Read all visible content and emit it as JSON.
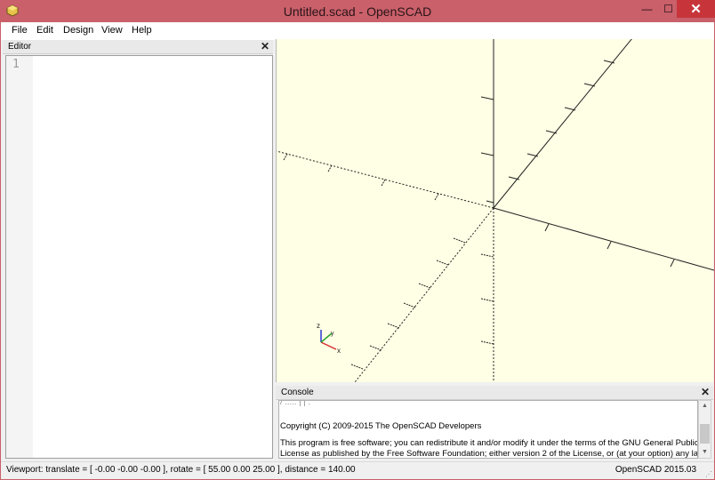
{
  "window": {
    "title": "Untitled.scad - OpenSCAD",
    "minimize_glyph": "—",
    "maximize_glyph": "☐",
    "close_glyph": "✕"
  },
  "menu": {
    "items": [
      {
        "label": "File"
      },
      {
        "label": "Edit"
      },
      {
        "label": "Design"
      },
      {
        "label": "View"
      },
      {
        "label": "Help"
      }
    ]
  },
  "editor": {
    "title": "Editor",
    "close_glyph": "✕",
    "line_numbers": [
      "1"
    ]
  },
  "viewport": {
    "axis_indicator": {
      "x_label": "x",
      "y_label": "y",
      "z_label": "z"
    }
  },
  "console": {
    "title": "Console",
    "close_glyph": "✕",
    "lines": [
      "Copyright (C) 2009-2015 The OpenSCAD Developers",
      "This program is free software; you can redistribute it and/or modify it under the terms of the GNU General Public",
      "License as published by the Free Software Foundation; either version 2 of the License, or (at your option) any later"
    ]
  },
  "statusbar": {
    "viewport_info": "Viewport: translate = [ -0.00 -0.00 -0.00 ], rotate = [ 55.00 0.00 25.00 ], distance = 140.00",
    "version": "OpenSCAD 2015.03"
  },
  "colors": {
    "titlebar": "#c9606a",
    "close_button": "#c7353b",
    "viewport_bg": "#ffffe5",
    "axis_x": "#d63030",
    "axis_y": "#28a028",
    "axis_z": "#2838d0"
  }
}
